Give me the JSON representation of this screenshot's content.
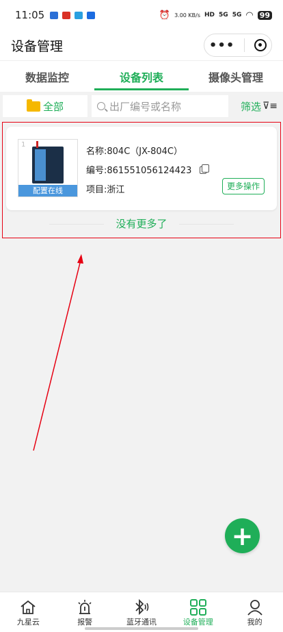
{
  "status_bar": {
    "time": "11:05",
    "net_speed": "3.00 KB/s",
    "hd": "HD",
    "signal1": "5G",
    "signal2": "5G",
    "battery": "99"
  },
  "nav": {
    "title": "设备管理",
    "more_label": "•••"
  },
  "tabs": [
    {
      "label": "数据监控",
      "active": false
    },
    {
      "label": "设备列表",
      "active": true
    },
    {
      "label": "摄像头管理",
      "active": false
    }
  ],
  "filter": {
    "all_label": "全部",
    "search_placeholder": "出厂编号或名称",
    "filter_label": "筛选",
    "funnel": "⊽≡"
  },
  "device": {
    "index": "1",
    "status": "配置在线",
    "name_label": "名称:",
    "name": "804C（JX-804C）",
    "serial_label": "编号:",
    "serial": "861551056124423",
    "project_label": "项目:",
    "project": "浙江",
    "more_label": "更多操作"
  },
  "list_end": "没有更多了",
  "fab_label": "+",
  "bottom_tabs": [
    {
      "label": "九星云",
      "icon": "home-icon",
      "active": false
    },
    {
      "label": "报警",
      "icon": "alarm-icon",
      "active": false
    },
    {
      "label": "蓝牙通讯",
      "icon": "bluetooth-icon",
      "active": false
    },
    {
      "label": "设备管理",
      "icon": "grid-icon",
      "active": true
    },
    {
      "label": "我的",
      "icon": "user-icon",
      "active": false
    }
  ],
  "colors": {
    "accent": "#1fae58",
    "highlight": "#e60012",
    "online": "#4a97dd"
  }
}
